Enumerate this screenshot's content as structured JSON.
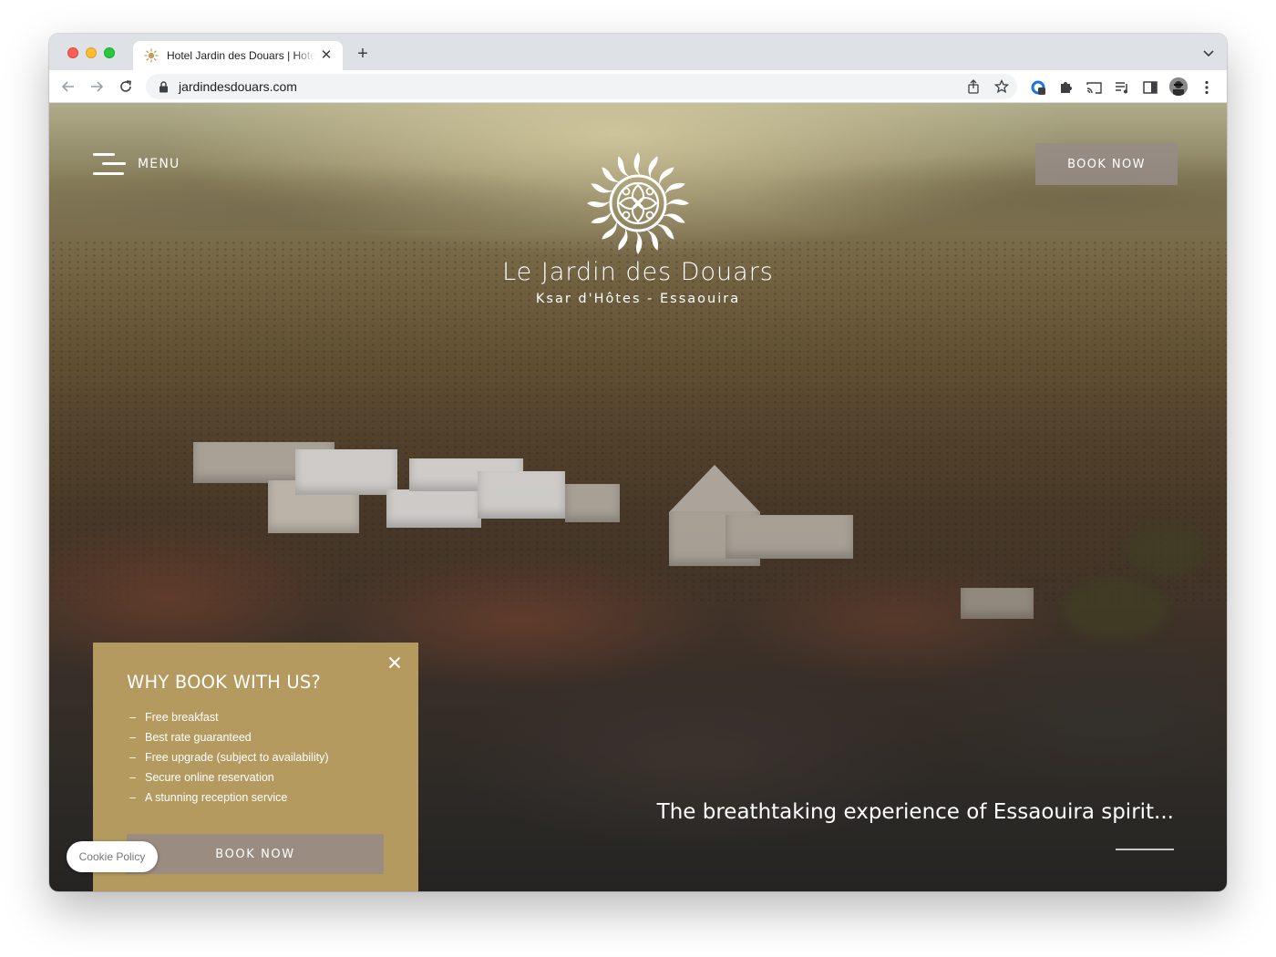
{
  "browser": {
    "tab_title": "Hotel Jardin des Douars | Hotel",
    "url": "jardindesdouars.com",
    "new_tab_label": "+",
    "icons": [
      "back-icon",
      "forward-icon",
      "reload-icon",
      "lock-icon",
      "share-icon",
      "bookmark-star-icon",
      "extension-icon",
      "puzzle-icon",
      "cast-icon",
      "reading-list-icon",
      "sidebar-icon",
      "avatar",
      "more-icon"
    ]
  },
  "header": {
    "menu_label": "MENU",
    "book_now_label": "BOOK NOW"
  },
  "brand": {
    "name": "Le Jardin des Douars",
    "subtitle": "Ksar d'Hôtes - Essaouira"
  },
  "hero": {
    "tagline": "The breathtaking experience of Essaouira spirit..."
  },
  "promo": {
    "title": "WHY BOOK WITH US?",
    "items": [
      "Free breakfast",
      "Best rate guaranteed",
      "Free upgrade (subject to availability)",
      "Secure online reservation",
      "A stunning reception service"
    ],
    "dash": "–",
    "book_now_label": "BOOK NOW",
    "accent_color": "#b49a5e"
  },
  "cookie": {
    "label": "Cookie Policy"
  }
}
